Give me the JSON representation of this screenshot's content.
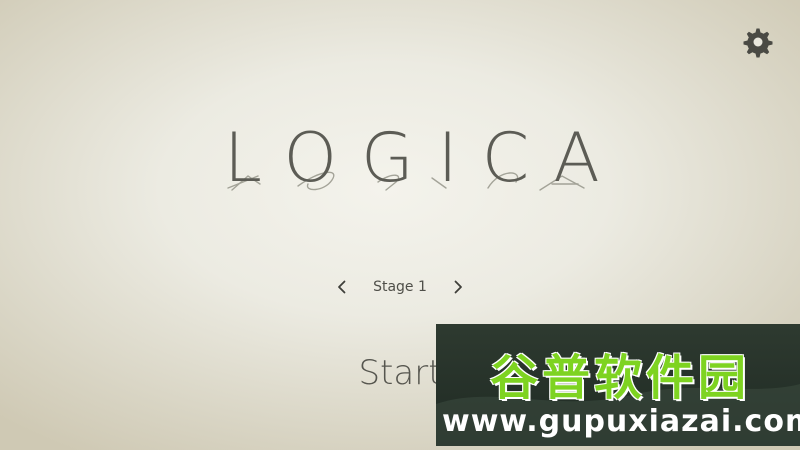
{
  "title": "LOGICA",
  "settings": {
    "icon": "gear-icon"
  },
  "stage": {
    "label": "Stage 1",
    "prev_icon": "chevron-left-icon",
    "next_icon": "chevron-right-icon"
  },
  "start": {
    "label": "Start"
  },
  "watermark": {
    "text_cn": "谷普软件园",
    "url": "www.gupuxiazai.com"
  },
  "colors": {
    "text": "#5c5c55",
    "background_center": "#f4f3ec",
    "background_edge": "#cfc9b4",
    "watermark_green": "#7ed321"
  }
}
